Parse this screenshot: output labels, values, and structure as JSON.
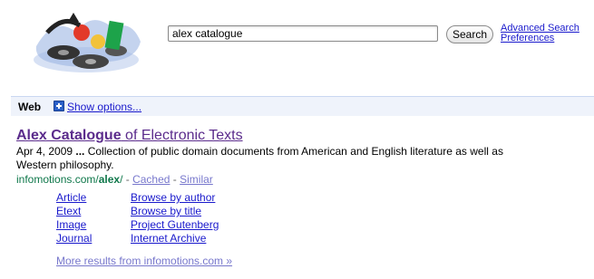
{
  "search": {
    "query": "alex catalogue",
    "button_label": "Search",
    "advanced_search_label": "Advanced Search",
    "preferences_label": "Preferences"
  },
  "web_bar": {
    "label": "Web",
    "show_options_label": "Show options..."
  },
  "result": {
    "title_bold": "Alex Catalogue",
    "title_rest": " of Electronic Texts",
    "date": "Apr 4, 2009",
    "ellipsis": " ... ",
    "snippet": "Collection of public domain documents from American and English literature as well as Western philosophy.",
    "url_prefix": "infomotions.com/",
    "url_bold": "alex",
    "url_suffix": "/",
    "separator": " - ",
    "cached_label": "Cached",
    "similar_label": "Similar"
  },
  "sitelinks": {
    "col1": [
      "Article",
      "Etext",
      "Image",
      "Journal"
    ],
    "col2": [
      "Browse by author",
      "Browse by title",
      "Project Gutenberg",
      "Internet Archive"
    ]
  },
  "more_results": "More results from infomotions.com »",
  "colors": {
    "link": "#1a1acc",
    "visited_title": "#5b2c8c",
    "url_green": "#0e774a",
    "web_bar_bg": "#eff3fb"
  }
}
